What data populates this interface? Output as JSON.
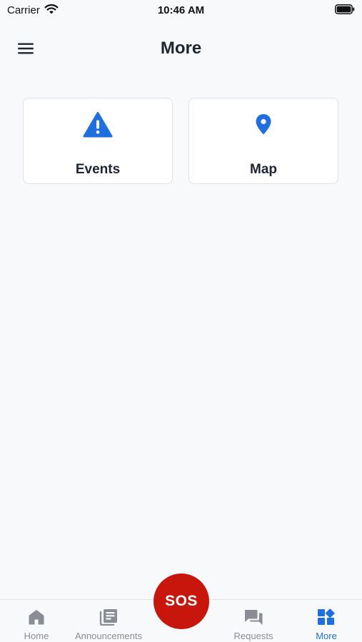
{
  "status_bar": {
    "carrier": "Carrier",
    "time": "10:46 AM"
  },
  "header": {
    "title": "More",
    "menu_icon": "hamburger-menu-icon"
  },
  "cards": [
    {
      "label": "Events",
      "icon": "warning-triangle-icon"
    },
    {
      "label": "Map",
      "icon": "map-pin-icon"
    }
  ],
  "tabs": [
    {
      "label": "Home",
      "icon": "home-icon",
      "active": false
    },
    {
      "label": "Announcements",
      "icon": "newspaper-icon",
      "active": false
    },
    {
      "label": "Requests",
      "icon": "chat-bubbles-icon",
      "active": false
    },
    {
      "label": "More",
      "icon": "grid-more-icon",
      "active": true
    }
  ],
  "sos_button": {
    "label": "SOS"
  },
  "colors": {
    "accent": "#1f6fe0",
    "sos": "#c8160c",
    "background": "#f8f9fb",
    "inactive_tab": "#8a8d93"
  }
}
